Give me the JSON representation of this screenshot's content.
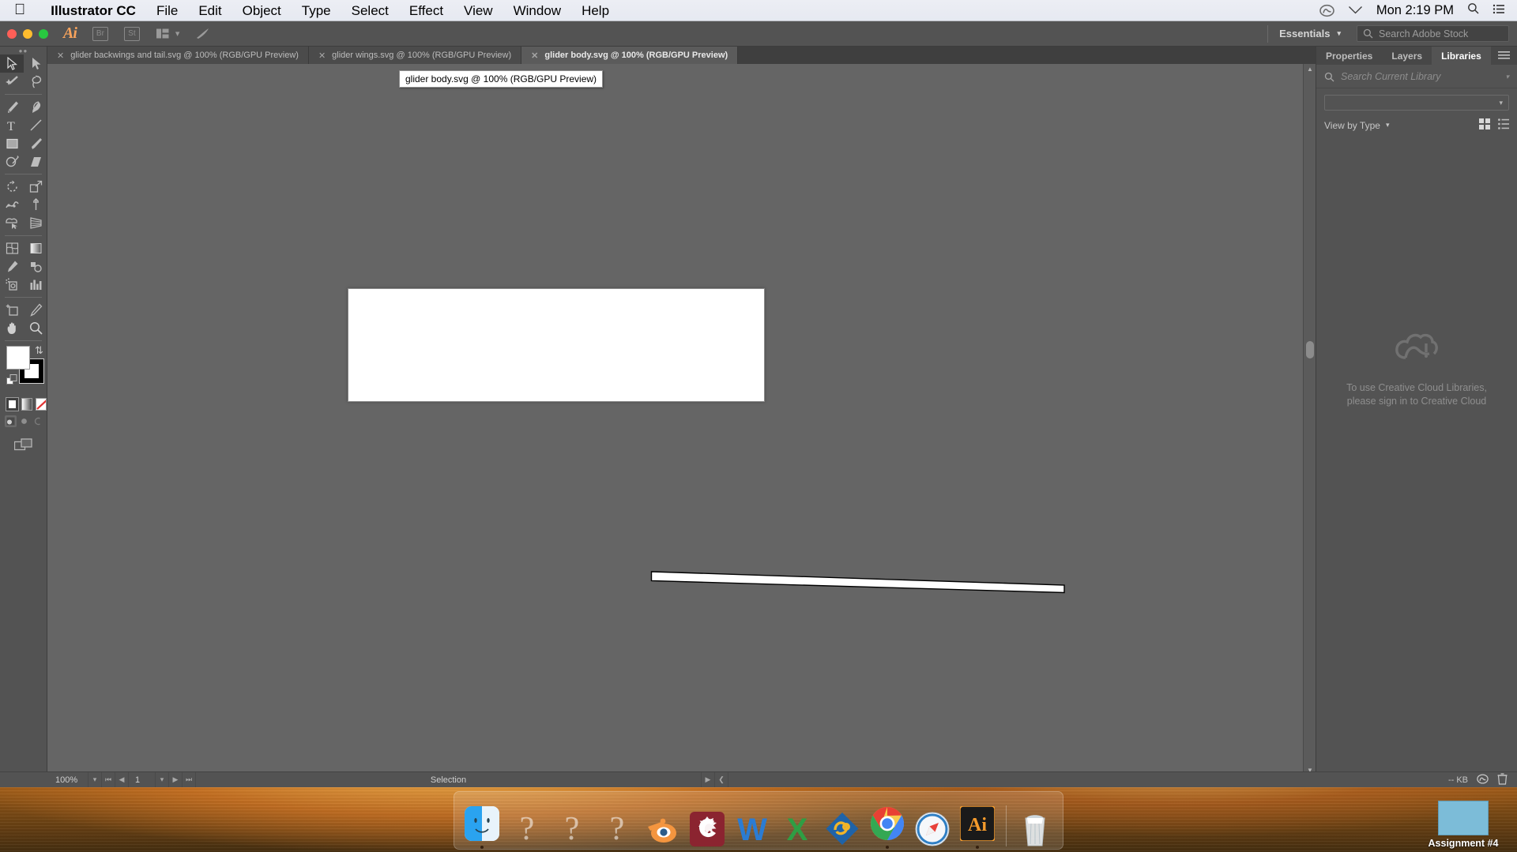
{
  "macbar": {
    "apple_icon": "apple-icon",
    "app_name": "Illustrator CC",
    "menus": [
      "File",
      "Edit",
      "Object",
      "Type",
      "Select",
      "Effect",
      "View",
      "Window",
      "Help"
    ],
    "status_icons": [
      "creative-cloud-icon",
      "wifi-icon",
      "search-icon",
      "control-center-icon"
    ],
    "clock": "Mon 2:19 PM"
  },
  "appbar": {
    "logo": "Ai",
    "buttons": [
      "Br",
      "St",
      "arrange-documents-icon",
      "chevron-down-icon",
      "stock-icon"
    ],
    "workspace": "Essentials",
    "workspace_chevron": "chevron-down-icon",
    "stock_search_placeholder": "Search Adobe Stock",
    "search_icon": "search-icon"
  },
  "tabs": [
    {
      "label": "glider backwings and tail.svg @ 100% (RGB/GPU Preview)",
      "active": false
    },
    {
      "label": "glider wings.svg @ 100% (RGB/GPU Preview)",
      "active": false
    },
    {
      "label": "glider body.svg @ 100% (RGB/GPU Preview)",
      "active": true
    }
  ],
  "tooltip": "glider body.svg @ 100% (RGB/GPU Preview)",
  "toolbar": {
    "tools": [
      {
        "name": "selection-tool",
        "selected": true
      },
      {
        "name": "direct-selection-tool",
        "selected": false
      },
      {
        "name": "magic-wand-tool",
        "selected": false
      },
      {
        "name": "lasso-tool",
        "selected": false
      },
      {
        "name": "pen-tool",
        "selected": false
      },
      {
        "name": "curvature-tool",
        "selected": false
      },
      {
        "name": "type-tool",
        "selected": false
      },
      {
        "name": "line-segment-tool",
        "selected": false
      },
      {
        "name": "rectangle-tool",
        "selected": false
      },
      {
        "name": "paintbrush-tool",
        "selected": false
      },
      {
        "name": "shaper-tool",
        "selected": false
      },
      {
        "name": "eraser-tool",
        "selected": false
      },
      {
        "name": "rotate-tool",
        "selected": false
      },
      {
        "name": "scale-tool",
        "selected": false
      },
      {
        "name": "width-tool",
        "selected": false
      },
      {
        "name": "free-transform-tool",
        "selected": false
      },
      {
        "name": "shape-builder-tool",
        "selected": false
      },
      {
        "name": "perspective-grid-tool",
        "selected": false
      },
      {
        "name": "mesh-tool",
        "selected": false
      },
      {
        "name": "gradient-tool",
        "selected": false
      },
      {
        "name": "eyedropper-tool",
        "selected": false
      },
      {
        "name": "blend-tool",
        "selected": false
      },
      {
        "name": "symbol-sprayer-tool",
        "selected": false
      },
      {
        "name": "column-graph-tool",
        "selected": false
      },
      {
        "name": "artboard-tool",
        "selected": false
      },
      {
        "name": "slice-tool",
        "selected": false
      },
      {
        "name": "hand-tool",
        "selected": false
      },
      {
        "name": "zoom-tool",
        "selected": false
      }
    ],
    "fill_color": "#ffffff",
    "stroke_color": "#000000",
    "color_modes": [
      "color-swatch",
      "gradient-swatch",
      "none-swatch"
    ],
    "draw_modes": [
      "draw-normal",
      "draw-behind",
      "draw-inside"
    ],
    "screen_mode": "change-screen-mode"
  },
  "canvas": {
    "artboard_background": "#ffffff",
    "shape_name": "glider-body-outline",
    "shape_stroke": "#000000",
    "shape_fill": "#ffffff"
  },
  "right_panel": {
    "tabs": [
      {
        "label": "Properties",
        "active": false
      },
      {
        "label": "Layers",
        "active": false
      },
      {
        "label": "Libraries",
        "active": true
      }
    ],
    "menu_icon": "panel-menu-icon",
    "search_placeholder": "Search Current Library",
    "search_icon": "search-icon",
    "library_select_value": "",
    "view_by_label": "View by Type",
    "view_mode_icons": [
      "grid-view-icon",
      "list-view-icon"
    ],
    "empty_icon": "creative-cloud-libraries-icon",
    "empty_message_line1": "To use Creative Cloud Libraries,",
    "empty_message_line2": "please sign in to Creative Cloud"
  },
  "statusbar": {
    "zoom": "100%",
    "zoom_chevron": "chevron-down-icon",
    "nav_first": "first-artboard-icon",
    "nav_prev": "previous-artboard-icon",
    "artboard_number": "1",
    "artboard_chevron": "chevron-down-icon",
    "nav_next": "next-artboard-icon",
    "nav_last": "last-artboard-icon",
    "current_tool": "Selection",
    "status_arrow": "status-menu-icon",
    "resize_handle": "resize-grip-icon",
    "file_size": "-- KB",
    "cc_icon": "creative-cloud-icon",
    "trash_icon": "trash-icon"
  },
  "dock": {
    "items": [
      {
        "name": "finder",
        "glyph": "finder-icon",
        "running": true
      },
      {
        "name": "unknown-app-1",
        "glyph": "question-mark-icon",
        "running": false
      },
      {
        "name": "unknown-app-2",
        "glyph": "question-mark-icon",
        "running": false
      },
      {
        "name": "unknown-app-3",
        "glyph": "question-mark-icon",
        "running": false
      },
      {
        "name": "blender",
        "glyph": "blender-icon",
        "running": false
      },
      {
        "name": "clion",
        "glyph": "clion-icon",
        "running": false
      },
      {
        "name": "microsoft-word",
        "glyph": "word-icon",
        "running": false
      },
      {
        "name": "microsoft-excel",
        "glyph": "excel-icon",
        "running": false
      },
      {
        "name": "foxit-reader",
        "glyph": "foxit-icon",
        "running": false
      },
      {
        "name": "google-chrome",
        "glyph": "chrome-icon",
        "running": true
      },
      {
        "name": "safari",
        "glyph": "safari-icon",
        "running": false
      },
      {
        "name": "illustrator",
        "glyph": "illustrator-icon",
        "running": true
      }
    ],
    "trash": {
      "name": "trash",
      "glyph": "trash-icon"
    }
  },
  "desktop": {
    "file_label": "Assignment #4",
    "file_icon": "document-thumbnail"
  }
}
